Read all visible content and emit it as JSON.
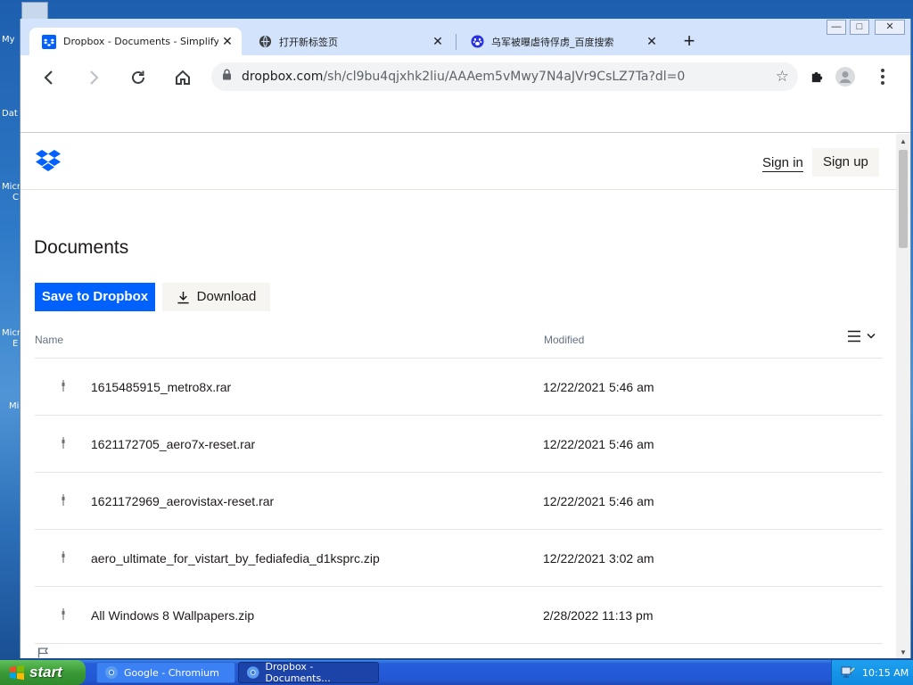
{
  "desktop": {
    "labels": [
      "My",
      "Dat",
      "Micr",
      "C",
      "Micr",
      "E",
      "Mi"
    ]
  },
  "browser": {
    "tabs": [
      {
        "title": "Dropbox - Documents - Simplify your",
        "active": true
      },
      {
        "title": "打开新标签页",
        "active": false
      },
      {
        "title": "乌军被曝虐待俘虏_百度搜索",
        "active": false
      }
    ],
    "close_glyph": "✕",
    "newtab_glyph": "+",
    "url_host": "dropbox.com",
    "url_path": "/sh/cl9bu4qjxhk2liu/AAAem5vMwy7N4aJVr9CsLZ7Ta?dl=0",
    "window_controls": [
      "—",
      "□",
      "✕"
    ]
  },
  "dropbox": {
    "signin": "Sign in",
    "signup": "Sign up",
    "title": "Documents",
    "save_label": "Save to Dropbox",
    "download_label": "Download",
    "col_name": "Name",
    "col_modified": "Modified",
    "files": [
      {
        "name": "1615485915_metro8x.rar",
        "modified": "12/22/2021 5:46 am"
      },
      {
        "name": "1621172705_aero7x-reset.rar",
        "modified": "12/22/2021 5:46 am"
      },
      {
        "name": "1621172969_aerovistax-reset.rar",
        "modified": "12/22/2021 5:46 am"
      },
      {
        "name": "aero_ultimate_for_vistart_by_fediafedia_d1ksprc.zip",
        "modified": "12/22/2021 3:02 am"
      },
      {
        "name": "All Windows 8 Wallpapers.zip",
        "modified": "2/28/2022 11:13 pm"
      }
    ]
  },
  "taskbar": {
    "start_label": "start",
    "tasks": [
      {
        "label": "Google - Chromium"
      },
      {
        "label": "Dropbox - Documents..."
      }
    ],
    "clock": "10:15 AM"
  },
  "colors": {
    "dropbox_blue": "#0061fe",
    "tabstrip": "#d2e3fb",
    "xp_taskbar": "#245edb",
    "xp_start": "#3a9a36"
  }
}
